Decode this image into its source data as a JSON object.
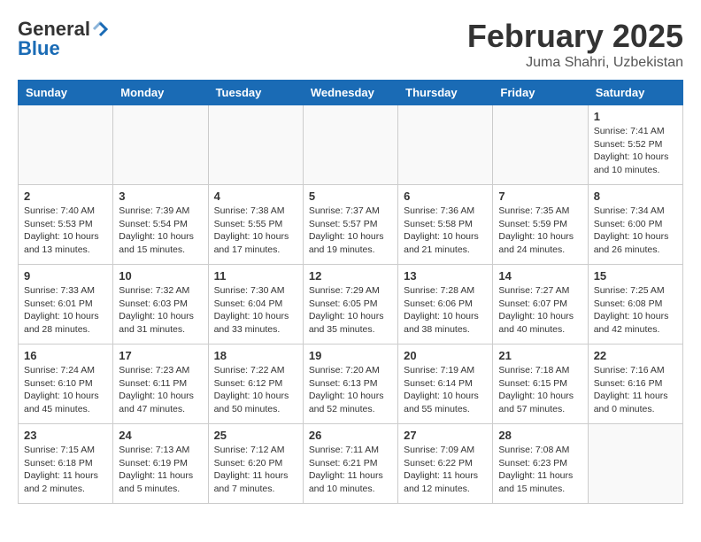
{
  "header": {
    "logo_general": "General",
    "logo_blue": "Blue",
    "title": "February 2025",
    "subtitle": "Juma Shahri, Uzbekistan"
  },
  "weekdays": [
    "Sunday",
    "Monday",
    "Tuesday",
    "Wednesday",
    "Thursday",
    "Friday",
    "Saturday"
  ],
  "weeks": [
    [
      {
        "day": "",
        "info": ""
      },
      {
        "day": "",
        "info": ""
      },
      {
        "day": "",
        "info": ""
      },
      {
        "day": "",
        "info": ""
      },
      {
        "day": "",
        "info": ""
      },
      {
        "day": "",
        "info": ""
      },
      {
        "day": "1",
        "info": "Sunrise: 7:41 AM\nSunset: 5:52 PM\nDaylight: 10 hours\nand 10 minutes."
      }
    ],
    [
      {
        "day": "2",
        "info": "Sunrise: 7:40 AM\nSunset: 5:53 PM\nDaylight: 10 hours\nand 13 minutes."
      },
      {
        "day": "3",
        "info": "Sunrise: 7:39 AM\nSunset: 5:54 PM\nDaylight: 10 hours\nand 15 minutes."
      },
      {
        "day": "4",
        "info": "Sunrise: 7:38 AM\nSunset: 5:55 PM\nDaylight: 10 hours\nand 17 minutes."
      },
      {
        "day": "5",
        "info": "Sunrise: 7:37 AM\nSunset: 5:57 PM\nDaylight: 10 hours\nand 19 minutes."
      },
      {
        "day": "6",
        "info": "Sunrise: 7:36 AM\nSunset: 5:58 PM\nDaylight: 10 hours\nand 21 minutes."
      },
      {
        "day": "7",
        "info": "Sunrise: 7:35 AM\nSunset: 5:59 PM\nDaylight: 10 hours\nand 24 minutes."
      },
      {
        "day": "8",
        "info": "Sunrise: 7:34 AM\nSunset: 6:00 PM\nDaylight: 10 hours\nand 26 minutes."
      }
    ],
    [
      {
        "day": "9",
        "info": "Sunrise: 7:33 AM\nSunset: 6:01 PM\nDaylight: 10 hours\nand 28 minutes."
      },
      {
        "day": "10",
        "info": "Sunrise: 7:32 AM\nSunset: 6:03 PM\nDaylight: 10 hours\nand 31 minutes."
      },
      {
        "day": "11",
        "info": "Sunrise: 7:30 AM\nSunset: 6:04 PM\nDaylight: 10 hours\nand 33 minutes."
      },
      {
        "day": "12",
        "info": "Sunrise: 7:29 AM\nSunset: 6:05 PM\nDaylight: 10 hours\nand 35 minutes."
      },
      {
        "day": "13",
        "info": "Sunrise: 7:28 AM\nSunset: 6:06 PM\nDaylight: 10 hours\nand 38 minutes."
      },
      {
        "day": "14",
        "info": "Sunrise: 7:27 AM\nSunset: 6:07 PM\nDaylight: 10 hours\nand 40 minutes."
      },
      {
        "day": "15",
        "info": "Sunrise: 7:25 AM\nSunset: 6:08 PM\nDaylight: 10 hours\nand 42 minutes."
      }
    ],
    [
      {
        "day": "16",
        "info": "Sunrise: 7:24 AM\nSunset: 6:10 PM\nDaylight: 10 hours\nand 45 minutes."
      },
      {
        "day": "17",
        "info": "Sunrise: 7:23 AM\nSunset: 6:11 PM\nDaylight: 10 hours\nand 47 minutes."
      },
      {
        "day": "18",
        "info": "Sunrise: 7:22 AM\nSunset: 6:12 PM\nDaylight: 10 hours\nand 50 minutes."
      },
      {
        "day": "19",
        "info": "Sunrise: 7:20 AM\nSunset: 6:13 PM\nDaylight: 10 hours\nand 52 minutes."
      },
      {
        "day": "20",
        "info": "Sunrise: 7:19 AM\nSunset: 6:14 PM\nDaylight: 10 hours\nand 55 minutes."
      },
      {
        "day": "21",
        "info": "Sunrise: 7:18 AM\nSunset: 6:15 PM\nDaylight: 10 hours\nand 57 minutes."
      },
      {
        "day": "22",
        "info": "Sunrise: 7:16 AM\nSunset: 6:16 PM\nDaylight: 11 hours\nand 0 minutes."
      }
    ],
    [
      {
        "day": "23",
        "info": "Sunrise: 7:15 AM\nSunset: 6:18 PM\nDaylight: 11 hours\nand 2 minutes."
      },
      {
        "day": "24",
        "info": "Sunrise: 7:13 AM\nSunset: 6:19 PM\nDaylight: 11 hours\nand 5 minutes."
      },
      {
        "day": "25",
        "info": "Sunrise: 7:12 AM\nSunset: 6:20 PM\nDaylight: 11 hours\nand 7 minutes."
      },
      {
        "day": "26",
        "info": "Sunrise: 7:11 AM\nSunset: 6:21 PM\nDaylight: 11 hours\nand 10 minutes."
      },
      {
        "day": "27",
        "info": "Sunrise: 7:09 AM\nSunset: 6:22 PM\nDaylight: 11 hours\nand 12 minutes."
      },
      {
        "day": "28",
        "info": "Sunrise: 7:08 AM\nSunset: 6:23 PM\nDaylight: 11 hours\nand 15 minutes."
      },
      {
        "day": "",
        "info": ""
      }
    ]
  ]
}
